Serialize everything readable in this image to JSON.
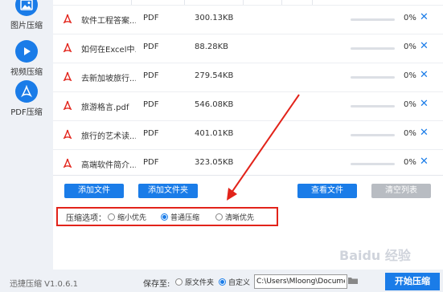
{
  "sidebar": {
    "items": [
      {
        "label": "图片压缩",
        "icon": "image-icon"
      },
      {
        "label": "视频压缩",
        "icon": "play-icon"
      },
      {
        "label": "PDF压缩",
        "icon": "pdf-icon",
        "active": true
      }
    ]
  },
  "files": [
    {
      "name": "软件工程答案...",
      "type": "PDF",
      "size": "300.13KB",
      "progress": "0%"
    },
    {
      "name": "如何在Excel中...",
      "type": "PDF",
      "size": "88.28KB",
      "progress": "0%"
    },
    {
      "name": "去新加坡旅行...",
      "type": "PDF",
      "size": "279.54KB",
      "progress": "0%"
    },
    {
      "name": "旅游格言.pdf",
      "type": "PDF",
      "size": "546.08KB",
      "progress": "0%"
    },
    {
      "name": "旅行的艺术读...",
      "type": "PDF",
      "size": "401.01KB",
      "progress": "0%"
    },
    {
      "name": "高端软件简介...",
      "type": "PDF",
      "size": "323.05KB",
      "progress": "0%"
    }
  ],
  "buttons": {
    "add_file": "添加文件",
    "add_folder": "添加文件夹",
    "view_file": "查看文件",
    "clear_list": "清空列表"
  },
  "options": {
    "label": "压缩选项：",
    "choices": [
      "缩小优先",
      "普通压缩",
      "清晰优先"
    ],
    "selected": "普通压缩"
  },
  "footer": {
    "version": "迅捷压缩 V1.0.6.1",
    "save_to": "保存至:",
    "original_folder": "原文件夹",
    "custom": "自定义",
    "path": "C:\\Users\\Mloong\\Documents",
    "start": "开始压缩",
    "selected": "自定义"
  },
  "watermark": "Baidu 经验",
  "colors": {
    "accent": "#1a7ce8",
    "pdf_red": "#e2231a",
    "annotation": "#e2231a"
  }
}
